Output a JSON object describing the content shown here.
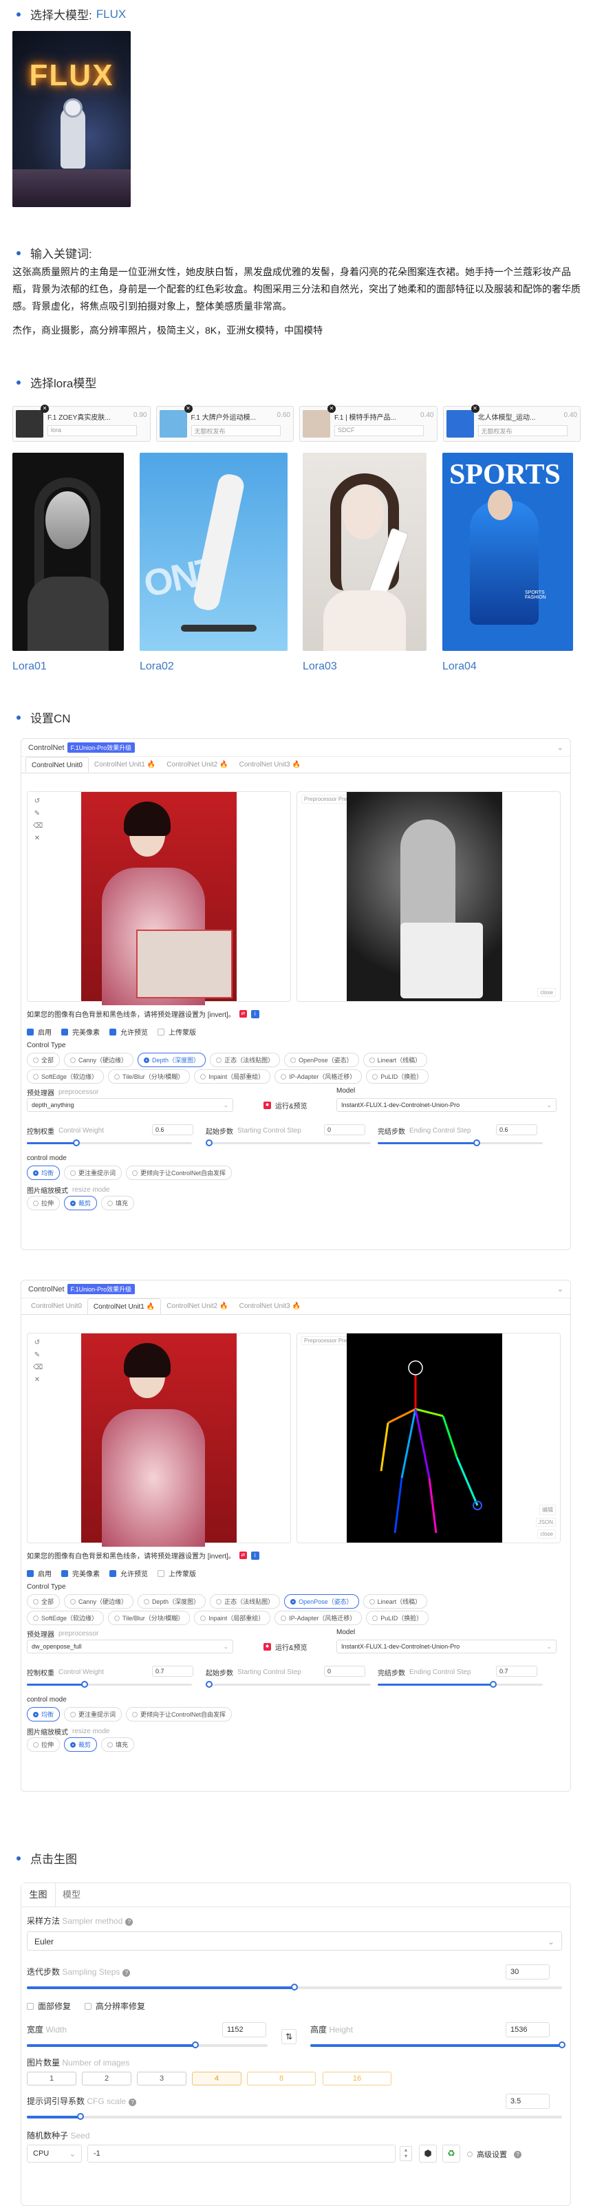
{
  "step1": {
    "label": "选择大模型:",
    "value": "FLUX"
  },
  "flux_image": {
    "text": "FLUX"
  },
  "step2": {
    "label": "输入关键词:"
  },
  "prompt_text": "这张高质量照片的主角是一位亚洲女性，她皮肤白皙，黑发盘成优雅的发髻，身着闪亮的花朵图案连衣裙。她手持一个兰蔻彩妆产品瓶，背景为浓郁的红色，身前是一个配套的红色彩妆盒。构图采用三分法和自然光，突出了她柔和的面部特征以及服装和配饰的奢华质感。背景虚化，将焦点吸引到拍摄对象上，整体美感质量非常高。",
  "tags_text": "杰作，商业摄影，高分辨率照片，极简主义，8K，亚洲女模特，中国模特",
  "step3": {
    "label": "选择lora模型"
  },
  "lora_cards": [
    {
      "name": "F.1 ZOEY真实皮肤...",
      "weight": "0.90",
      "select": "lora"
    },
    {
      "name": "F.1 大牌户外运动模...",
      "weight": "0.60",
      "select": "无额权发布"
    },
    {
      "name": "F.1 | 模特手持产品...",
      "weight": "0.40",
      "select": "SDCF"
    },
    {
      "name": "北人体模型_运动...",
      "weight": "0.40",
      "select": "无额权发布"
    }
  ],
  "lora_labels": [
    "Lora01",
    "Lora02",
    "Lora03",
    "Lora04"
  ],
  "lora_image_text": {
    "sports": "SPORTS",
    "fashion": "SPORTS FASHION",
    "ont": "ONT"
  },
  "step4": {
    "label": "设置CN"
  },
  "cn": [
    {
      "title": "ControlNet",
      "badge": "F.1Union-Pro效果升级",
      "tabs": [
        "ControlNet Unit0",
        "ControlNet Unit1",
        "ControlNet Unit2",
        "ControlNet Unit3"
      ],
      "active_tab": 0,
      "preview_label": "Preprocessor Preview",
      "side_tools": [
        "close"
      ],
      "hint": "如果您的图像有白色背景和黑色线条，请将预处理器设置为 [invert]。",
      "checks": [
        {
          "label": "启用",
          "on": true
        },
        {
          "label": "完美像素",
          "on": true
        },
        {
          "label": "允许预览",
          "on": true
        },
        {
          "label": "上传蒙版",
          "on": false
        }
      ],
      "control_type_label": "Control Type",
      "types_row1": [
        "全部",
        "Canny（硬边缘）",
        "Depth（深度图）",
        "正态（法线贴图）",
        "OpenPose（姿态）",
        "Lineart（线稿）"
      ],
      "types_row2": [
        "SoftEdge（软边缘）",
        "Tile/Blur（分块/模糊）",
        "Inpaint（局部重绘）",
        "IP-Adapter（风格迁移）",
        "PuLID（换脸）"
      ],
      "active_type": "Depth（深度图）",
      "preprocessor_label": "预处理器",
      "preprocessor_sub": "preprocessor",
      "preprocessor": "depth_anything",
      "run_label": "运行&预览",
      "model_label": "Model",
      "model": "InstantX-FLUX.1-dev-Controlnet-Union-Pro",
      "weight_label": "控制权重",
      "weight_sub": "Control Weight",
      "weight": "0.6",
      "weight_frac": 0.3,
      "start_label": "起始步数",
      "start_sub": "Starting Control Step",
      "start": "0",
      "start_frac": 0,
      "end_label": "完结步数",
      "end_sub": "Ending Control Step",
      "end": "0.6",
      "end_frac": 0.6,
      "mode_label": "control mode",
      "modes": [
        "均衡",
        "更注重提示词",
        "更倾向于让ControlNet自由发挥"
      ],
      "active_mode": 0,
      "resize_label": "图片缩放模式",
      "resize_sub": "resize mode",
      "resizes": [
        "拉伸",
        "裁剪",
        "填充"
      ],
      "active_resize": 1
    },
    {
      "title": "ControlNet",
      "badge": "F.1Union-Pro效果升级",
      "tabs": [
        "ControlNet Unit0",
        "ControlNet Unit1",
        "ControlNet Unit2",
        "ControlNet Unit3"
      ],
      "active_tab": 1,
      "preview_label": "Preprocessor Preview",
      "side_tools": [
        "编辑",
        "JSON",
        "close"
      ],
      "hint": "如果您的图像有白色背景和黑色线条，请将预处理器设置为 [invert]。",
      "checks": [
        {
          "label": "启用",
          "on": true
        },
        {
          "label": "完美像素",
          "on": true
        },
        {
          "label": "允许预览",
          "on": true
        },
        {
          "label": "上传蒙版",
          "on": false
        }
      ],
      "control_type_label": "Control Type",
      "types_row1": [
        "全部",
        "Canny（硬边缘）",
        "Depth（深度图）",
        "正态（法线贴图）",
        "OpenPose（姿态）",
        "Lineart（线稿）"
      ],
      "types_row2": [
        "SoftEdge（软边缘）",
        "Tile/Blur（分块/模糊）",
        "Inpaint（局部重绘）",
        "IP-Adapter（风格迁移）",
        "PuLID（换脸）"
      ],
      "active_type": "OpenPose（姿态）",
      "preprocessor_label": "预处理器",
      "preprocessor_sub": "preprocessor",
      "preprocessor": "dw_openpose_full",
      "run_label": "运行&预览",
      "model_label": "Model",
      "model": "InstantX-FLUX.1-dev-Controlnet-Union-Pro",
      "weight_label": "控制权重",
      "weight_sub": "Control Weight",
      "weight": "0.7",
      "weight_frac": 0.35,
      "start_label": "起始步数",
      "start_sub": "Starting Control Step",
      "start": "0",
      "start_frac": 0,
      "end_label": "完结步数",
      "end_sub": "Ending Control Step",
      "end": "0.7",
      "end_frac": 0.7,
      "mode_label": "control mode",
      "modes": [
        "均衡",
        "更注重提示词",
        "更倾向于让ControlNet自由发挥"
      ],
      "active_mode": 0,
      "resize_label": "图片缩放模式",
      "resize_sub": "resize mode",
      "resizes": [
        "拉伸",
        "裁剪",
        "填充"
      ],
      "active_resize": 1
    }
  ],
  "step5": {
    "label": "点击生图"
  },
  "gen": {
    "tabs": [
      "生图",
      "模型"
    ],
    "sampler_label": "采样方法",
    "sampler_sub": "Sampler method",
    "sampler": "Euler",
    "steps_label": "迭代步数",
    "steps_sub": "Sampling Steps",
    "steps": "30",
    "steps_frac": 0.5,
    "face_fix": "面部修复",
    "hires_fix": "高分辨率修复",
    "width_label": "宽度",
    "width_sub": "Width",
    "width": "1152",
    "width_frac": 0.7,
    "height_label": "高度",
    "height_sub": "Height",
    "height": "1536",
    "height_frac": 1.0,
    "count_label": "图片数量",
    "count_sub": "Number of images",
    "counts": [
      "1",
      "2",
      "3",
      "4",
      "8",
      "16"
    ],
    "active_count": 3,
    "cfg_label": "提示词引导系数",
    "cfg_sub": "CFG scale",
    "cfg": "3.5",
    "cfg_frac": 0.1,
    "seed_label": "随机数种子",
    "seed_sub": "Seed",
    "device": "CPU",
    "seed": "-1",
    "advanced": "高级设置"
  },
  "colors": {
    "accent": "#2f6fe0",
    "link": "#3a77c2",
    "badge": "#4d6bf2",
    "count_active": "#e79a2a"
  }
}
